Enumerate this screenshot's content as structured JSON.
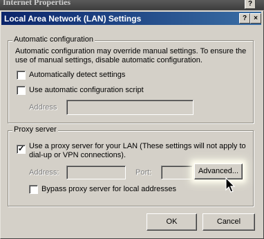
{
  "background_window": {
    "title": "Internet Properties",
    "help_label": "?"
  },
  "dialog": {
    "title": "Local Area Network (LAN) Settings",
    "help_label": "?",
    "close_label": "×"
  },
  "auto_config": {
    "legend": "Automatic configuration",
    "description": "Automatic configuration may override manual settings.  To ensure the use of manual settings, disable automatic configuration.",
    "detect_label": "Automatically detect settings",
    "detect_checked": false,
    "script_label": "Use automatic configuration script",
    "script_checked": false,
    "address_label": "Address",
    "address_value": ""
  },
  "proxy": {
    "legend": "Proxy server",
    "use_proxy_label": "Use a proxy server for your LAN (These settings will not apply to dial-up or VPN connections).",
    "use_proxy_checked": true,
    "address_label": "Address:",
    "address_value": "",
    "port_label": "Port:",
    "port_value": "",
    "advanced_label": "Advanced...",
    "bypass_label": "Bypass proxy server for local addresses",
    "bypass_checked": false
  },
  "buttons": {
    "ok": "OK",
    "cancel": "Cancel"
  },
  "icons": {
    "cursor": "arrow-cursor-icon",
    "checkmark": "checkmark-icon"
  }
}
